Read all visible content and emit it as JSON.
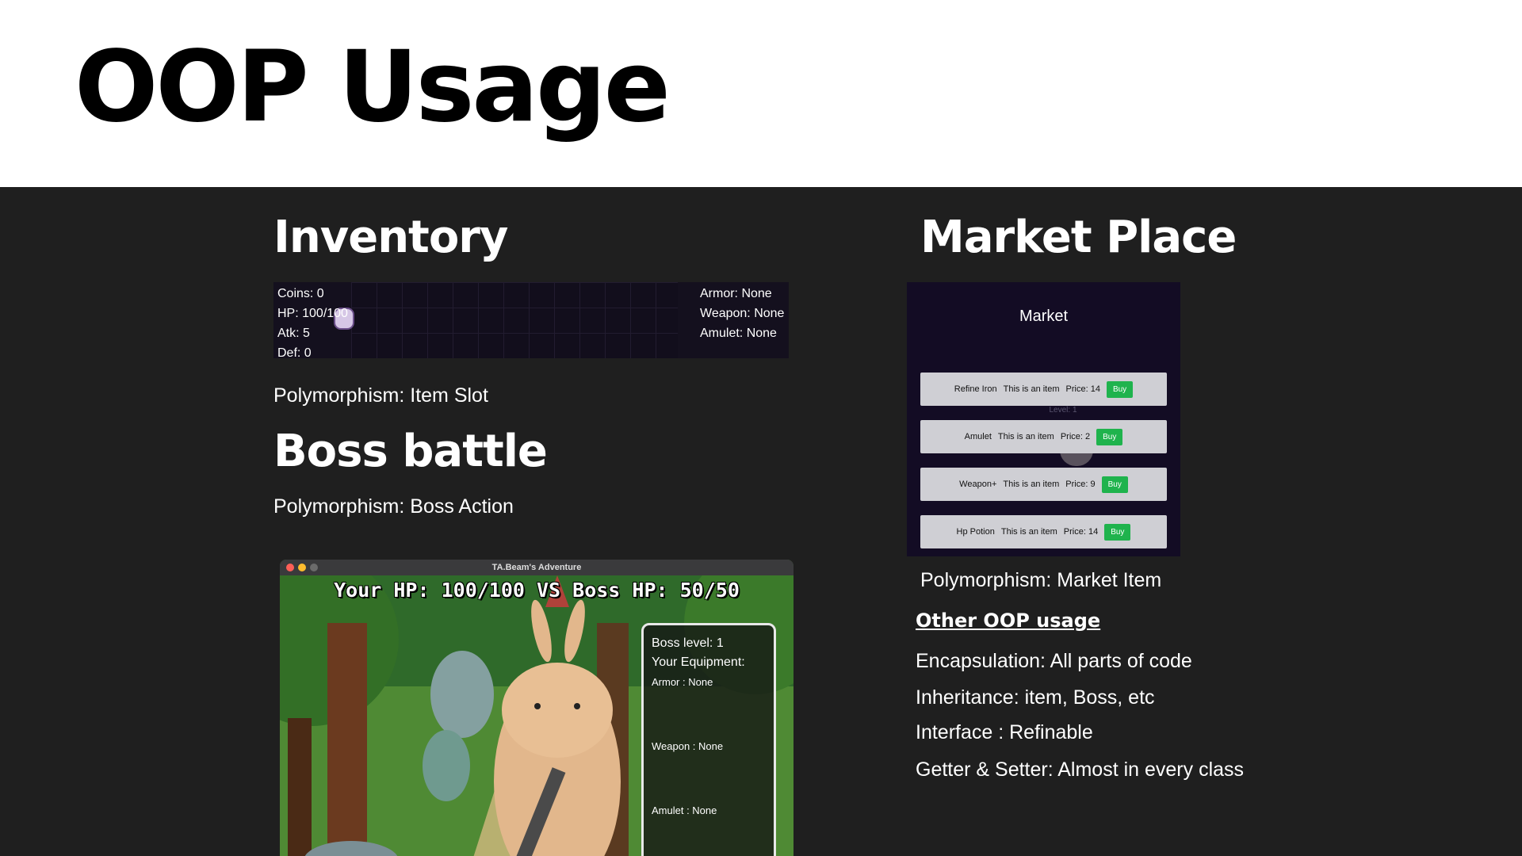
{
  "page": {
    "title": "OOP Usage"
  },
  "inventory": {
    "heading": "Inventory",
    "stats": [
      "Coins: 0",
      "HP: 100/100",
      "Atk: 5",
      "Def: 0"
    ],
    "equipment": [
      "Armor: None",
      "Weapon: None",
      "Amulet: None"
    ],
    "caption": "Polymorphism: Item Slot"
  },
  "boss": {
    "heading": "Boss battle",
    "caption": "Polymorphism: Boss Action",
    "window_title": "TA.Beam's Adventure",
    "hp_text": "Your HP: 100/100 VS  Boss HP: 50/50",
    "panel": {
      "level": "Boss level: 1",
      "equipment_title": "Your Equipment:",
      "armor": "Armor : None",
      "weapon": "Weapon : None",
      "amulet": "Amulet : None"
    }
  },
  "market": {
    "heading": "Market Place",
    "title": "Market",
    "level_text": "Level: 1",
    "items": [
      {
        "name": "Refine Iron",
        "desc": "This is an item",
        "price": "Price: 14",
        "button": "Buy"
      },
      {
        "name": "Amulet",
        "desc": "This is an item",
        "price": "Price: 2",
        "button": "Buy"
      },
      {
        "name": "Weapon+",
        "desc": "This is an item",
        "price": "Price: 9",
        "button": "Buy"
      },
      {
        "name": "Hp Potion",
        "desc": "This is an item",
        "price": "Price: 14",
        "button": "Buy"
      }
    ],
    "caption": "Polymorphism: Market Item"
  },
  "other": {
    "link": "Other OOP usage",
    "lines": [
      "Encapsulation: All parts of code",
      "Inheritance: item, Boss, etc",
      "Interface : Refinable",
      "Getter & Setter: Almost in every class"
    ]
  },
  "colors": {
    "dark_bg": "#1f1f1f",
    "buy_green": "#1fb34d",
    "market_bg": "#130c24"
  }
}
